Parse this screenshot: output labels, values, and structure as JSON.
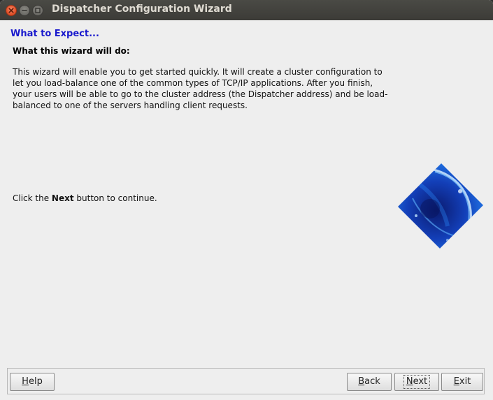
{
  "window": {
    "title": "Dispatcher Configuration Wizard"
  },
  "icons": {
    "close": "close-icon",
    "minimize": "minimize-icon",
    "maximize": "maximize-icon",
    "logo": "dispatcher-logo"
  },
  "page": {
    "heading": "What to Expect...",
    "subheading": "What this wizard will do:",
    "description": "This wizard will enable you to get started quickly. It will create a cluster configuration to let you load-balance one of the common types of TCP/IP applications. After you finish, your users will be able to go to the cluster address (the Dispatcher address) and be load-balanced to one of the servers handling client requests.",
    "continue_prefix": "Click the ",
    "continue_bold": "Next",
    "continue_suffix": " button to continue."
  },
  "buttons": {
    "help": {
      "mnemonic": "H",
      "rest": "elp"
    },
    "back": {
      "mnemonic": "B",
      "rest": "ack"
    },
    "next": {
      "mnemonic": "N",
      "rest": "ext"
    },
    "exit": {
      "mnemonic": "E",
      "rest": "xit"
    }
  },
  "colors": {
    "heading": "#1a1acd",
    "titlebar": "#3c3b37",
    "close_button": "#e2532c"
  }
}
